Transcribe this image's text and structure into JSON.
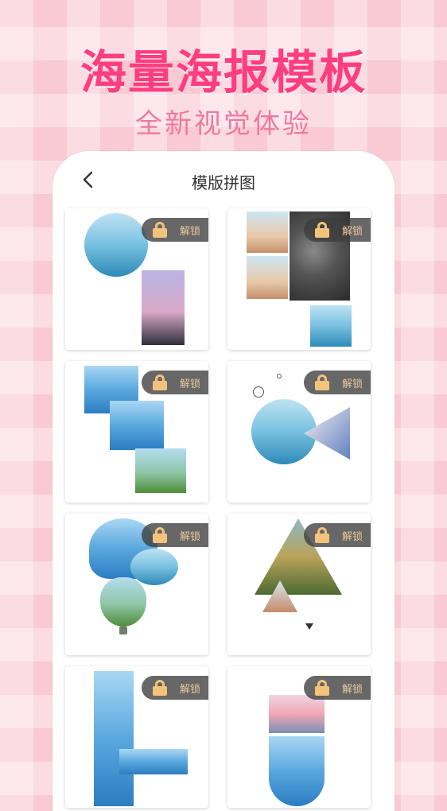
{
  "hero": {
    "title": "海量海报模板",
    "subtitle": "全新视觉体验"
  },
  "nav": {
    "title": "模版拼图",
    "back_icon": "chevron-left-icon"
  },
  "templates": [
    {
      "lock_label": "解锁"
    },
    {
      "lock_label": "解锁"
    },
    {
      "lock_label": "解锁"
    },
    {
      "lock_label": "解锁"
    },
    {
      "lock_label": "解锁"
    },
    {
      "lock_label": "解锁"
    },
    {
      "lock_label": "解锁"
    },
    {
      "lock_label": "解锁"
    }
  ],
  "colors": {
    "hero_title": "#ff3d7f",
    "hero_subtitle": "#f2789e",
    "lock_badge": "#3c3c3c",
    "lock_gold": "#f3c37b"
  }
}
